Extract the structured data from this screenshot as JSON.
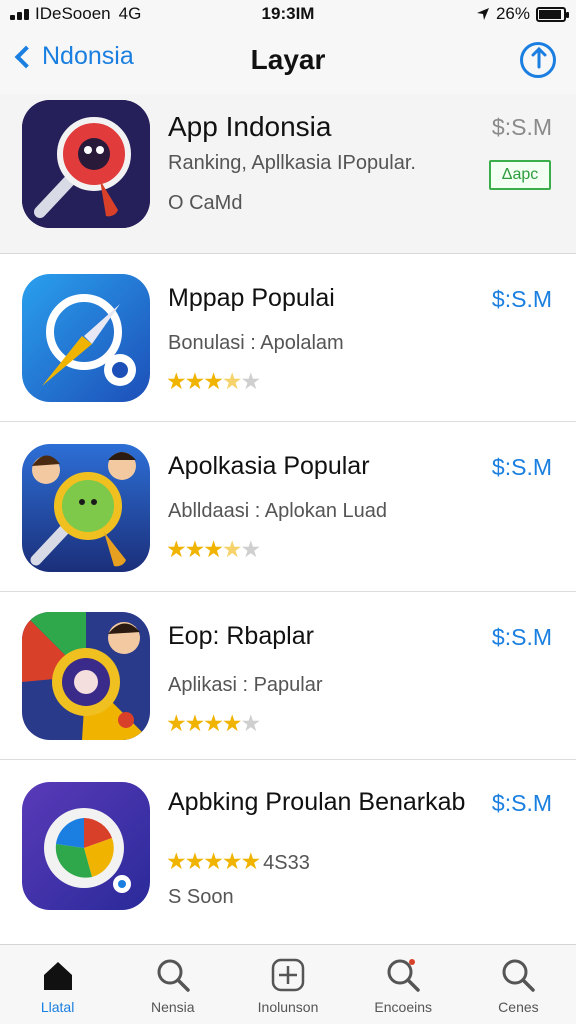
{
  "status_bar": {
    "carrier": "IDeSooen",
    "network": "4G",
    "time": "19:3IM",
    "battery": "26%",
    "battery_level": 0.9
  },
  "nav": {
    "back_label": "Ndonsia",
    "title": "Layar"
  },
  "featured": {
    "name": "App Indonsia",
    "subtitle": "Ranking, Apllkasia IPopular.",
    "meta": "O CaMd",
    "price": "$:S.M",
    "badge": "Δapc"
  },
  "apps": [
    {
      "name": "Mppap Populai",
      "subtitle": "Bonulasi : Apolalam",
      "price": "$:S.M",
      "rating": 3.5
    },
    {
      "name": "Apolkasia Popular",
      "subtitle": "Ablldaasi : Aplokan Luad",
      "price": "$:S.M",
      "rating": 3.5
    },
    {
      "name": "Eop: Rbaplar",
      "subtitle": "Aplikasi : Papular",
      "price": "$:S.M",
      "rating": 4
    },
    {
      "name": "Apbking Proulan Benarkab",
      "stars_text": "4S33",
      "meta": "S Soon",
      "price": "$:S.M",
      "rating": 5
    }
  ],
  "tabs": [
    {
      "label": "Llatal",
      "icon": "home-icon",
      "active": true
    },
    {
      "label": "Nensia",
      "icon": "search-icon",
      "active": false
    },
    {
      "label": "Inolunson",
      "icon": "plus-icon",
      "active": false
    },
    {
      "label": "Encoeins",
      "icon": "search-icon",
      "active": false
    },
    {
      "label": "Cenes",
      "icon": "search-icon",
      "active": false
    }
  ],
  "colors": {
    "accent": "#1a7fe0",
    "star": "#f0b400",
    "badge": "#3aae4a"
  }
}
